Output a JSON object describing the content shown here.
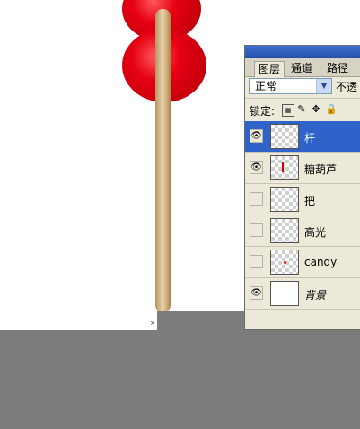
{
  "panel": {
    "tabs": [
      {
        "label": "图层",
        "active": true
      },
      {
        "label": "通道",
        "active": false
      },
      {
        "label": "路径",
        "active": false
      }
    ],
    "blend_mode": "正常",
    "opacity_label": "不透",
    "lock_label": "锁定:",
    "layers": [
      {
        "name": "杆",
        "visible": true,
        "selected": true,
        "thumb": "transparent"
      },
      {
        "name": "糖葫芦",
        "visible": true,
        "selected": false,
        "thumb": "transparent-red-line"
      },
      {
        "name": "把",
        "visible": false,
        "selected": false,
        "thumb": "transparent"
      },
      {
        "name": "高光",
        "visible": false,
        "selected": false,
        "thumb": "transparent"
      },
      {
        "name": "candy",
        "visible": false,
        "selected": false,
        "thumb": "transparent-red-dot"
      },
      {
        "name": "背景",
        "visible": true,
        "selected": false,
        "thumb": "white"
      }
    ]
  },
  "icons": {
    "visibility": "eye-icon",
    "lock_transparent": "lock-transparency-icon",
    "lock_image": "brush-icon",
    "lock_position": "move-icon",
    "lock_all": "lock-icon",
    "cursor": "magnifier-cursor-icon"
  },
  "colors": {
    "candy": "#e60012",
    "stick": "#dcc39a",
    "selected_layer": "#2f63c9",
    "panel_bg": "#ece9d8",
    "workspace_gray": "#7c7c7c"
  }
}
